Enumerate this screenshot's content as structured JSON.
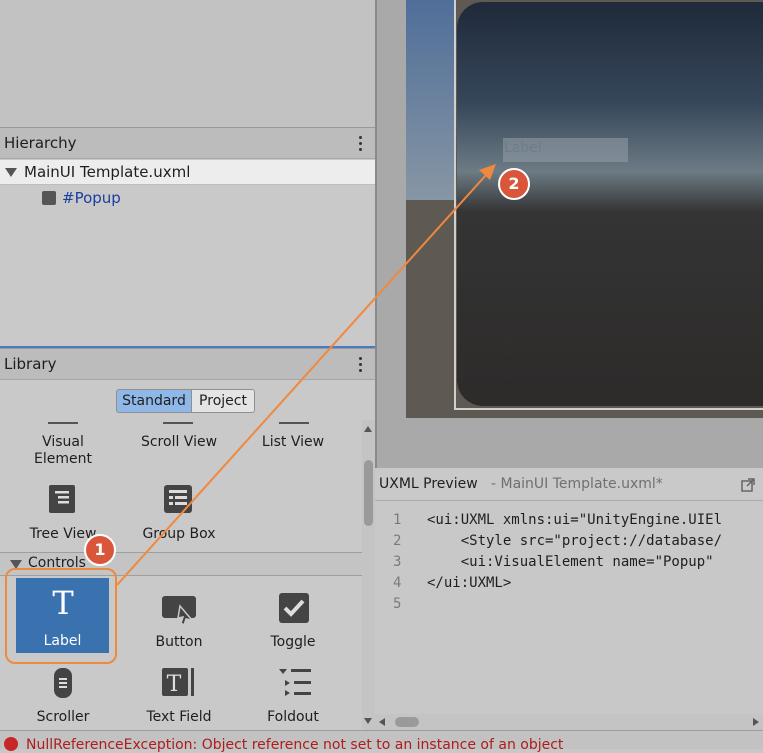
{
  "hierarchy": {
    "title": "Hierarchy",
    "root": "MainUI Template.uxml",
    "child": "#Popup"
  },
  "library": {
    "title": "Library",
    "tabs": [
      "Standard",
      "Project"
    ],
    "containers": [
      {
        "label": "Visual\nElement",
        "icon": "visual-element-icon"
      },
      {
        "label": "Scroll View",
        "icon": "scroll-view-icon"
      },
      {
        "label": "List View",
        "icon": "list-view-icon"
      },
      {
        "label": "Tree View",
        "icon": "tree-view-icon"
      },
      {
        "label": "Group Box",
        "icon": "group-box-icon"
      }
    ],
    "controls_header": "Controls",
    "controls": [
      {
        "label": "Label",
        "icon": "label-icon",
        "selected": true
      },
      {
        "label": "Button",
        "icon": "button-icon"
      },
      {
        "label": "Toggle",
        "icon": "toggle-icon"
      },
      {
        "label": "Scroller",
        "icon": "scroller-icon"
      },
      {
        "label": "Text Field",
        "icon": "text-field-icon"
      },
      {
        "label": "Foldout",
        "icon": "foldout-icon"
      }
    ]
  },
  "viewport": {
    "label_text": "Label"
  },
  "uxml_preview": {
    "title": "UXML Preview",
    "file": "- MainUI Template.uxml*",
    "lines": [
      {
        "no": "1",
        "text": "<ui:UXML xmlns:ui=\"UnityEngine.UIEl"
      },
      {
        "no": "2",
        "text": "    <Style src=\"project://database/"
      },
      {
        "no": "3",
        "text": "    <ui:VisualElement name=\"Popup\""
      },
      {
        "no": "4",
        "text": "</ui:UXML>"
      },
      {
        "no": "5",
        "text": ""
      }
    ]
  },
  "status": {
    "message": "NullReferenceException: Object reference not set to an instance of an object"
  },
  "callouts": [
    "1",
    "2"
  ],
  "colors": {
    "selection": "#3a72b0",
    "callout": "#d9563b",
    "arrow": "#f0883e",
    "link": "#1b3fa0"
  }
}
